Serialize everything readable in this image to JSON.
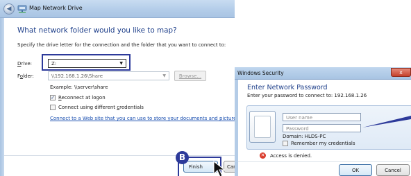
{
  "map_drive": {
    "title": "Map Network Drive",
    "heading": "What network folder would you like to map?",
    "specify": "Specify the drive letter for the connection and the folder that you want to connect to:",
    "drive_label_u": "D",
    "drive_label_rest": "rive:",
    "drive_value": "Z:",
    "folder_label_a": "F",
    "folder_label_u": "o",
    "folder_label_b": "lder:",
    "folder_value": "\\\\192.168.1.26\\Share",
    "browse_label": "Browse...",
    "example": "Example: \\\\server\\share",
    "reconnect_u": "R",
    "reconnect_rest": "econnect at logon",
    "reconnect_checked": true,
    "diffcred_a": "Connect using different ",
    "diffcred_u": "c",
    "diffcred_b": "redentials",
    "diffcred_checked": false,
    "link": "Connect to a Web site that you can use to store your documents and pictures.",
    "finish_label": "Finish",
    "cancel_label": "Canc",
    "marker": "B"
  },
  "security": {
    "title": "Windows Security",
    "close_glyph": "x",
    "heading": "Enter Network Password",
    "subtitle": "Enter your password to connect to: 192.168.1.26",
    "username_placeholder": "User name",
    "password_placeholder": "Password",
    "domain": "Domain: HLDS-PC",
    "remember": "Remember my credentials",
    "remember_checked": false,
    "error": "Access is denied.",
    "ok_label": "OK",
    "cancel_label": "Cancel"
  },
  "colors": {
    "callout": "#2d3a9a",
    "heading": "#1e3f8a",
    "link": "#1a4fb0",
    "error": "#d93a2a"
  },
  "icons": [
    "back-arrow-icon",
    "network-drive-icon",
    "dropdown-arrow-icon",
    "checkmark-icon",
    "close-icon",
    "error-icon",
    "mouse-cursor-icon",
    "user-tile-icon"
  ]
}
